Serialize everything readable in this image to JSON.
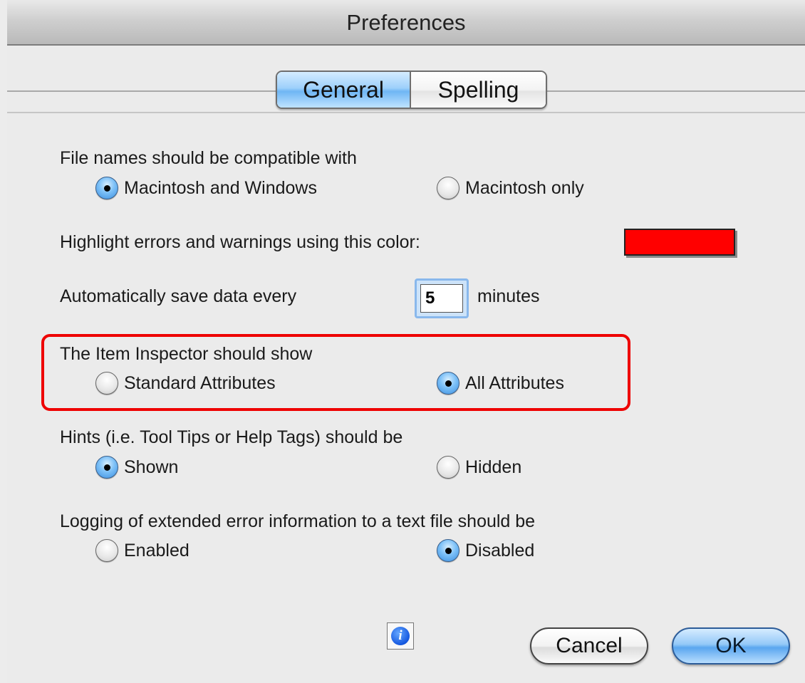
{
  "window": {
    "title": "Preferences"
  },
  "tabs": [
    {
      "label": "General",
      "selected": true
    },
    {
      "label": "Spelling",
      "selected": false
    }
  ],
  "sections": {
    "filenames": {
      "label": "File names should be compatible with",
      "options": [
        {
          "label": "Macintosh and Windows",
          "selected": true
        },
        {
          "label": "Macintosh only",
          "selected": false
        }
      ]
    },
    "highlight": {
      "label": "Highlight errors and warnings using this color:",
      "color": "#ff0000"
    },
    "autosave": {
      "label": "Automatically save data every",
      "value": "5",
      "unit": "minutes"
    },
    "inspector": {
      "label": "The Item Inspector should show",
      "options": [
        {
          "label": "Standard Attributes",
          "selected": false
        },
        {
          "label": "All Attributes",
          "selected": true
        }
      ],
      "highlight_color": "#ee0000"
    },
    "hints": {
      "label": "Hints (i.e. Tool Tips or Help Tags) should be",
      "options": [
        {
          "label": "Shown",
          "selected": true
        },
        {
          "label": "Hidden",
          "selected": false
        }
      ]
    },
    "logging": {
      "label": "Logging of extended error information to a text file should be",
      "options": [
        {
          "label": "Enabled",
          "selected": false
        },
        {
          "label": "Disabled",
          "selected": true
        }
      ]
    }
  },
  "buttons": {
    "info_icon": "info-icon",
    "cancel": "Cancel",
    "ok": "OK"
  }
}
